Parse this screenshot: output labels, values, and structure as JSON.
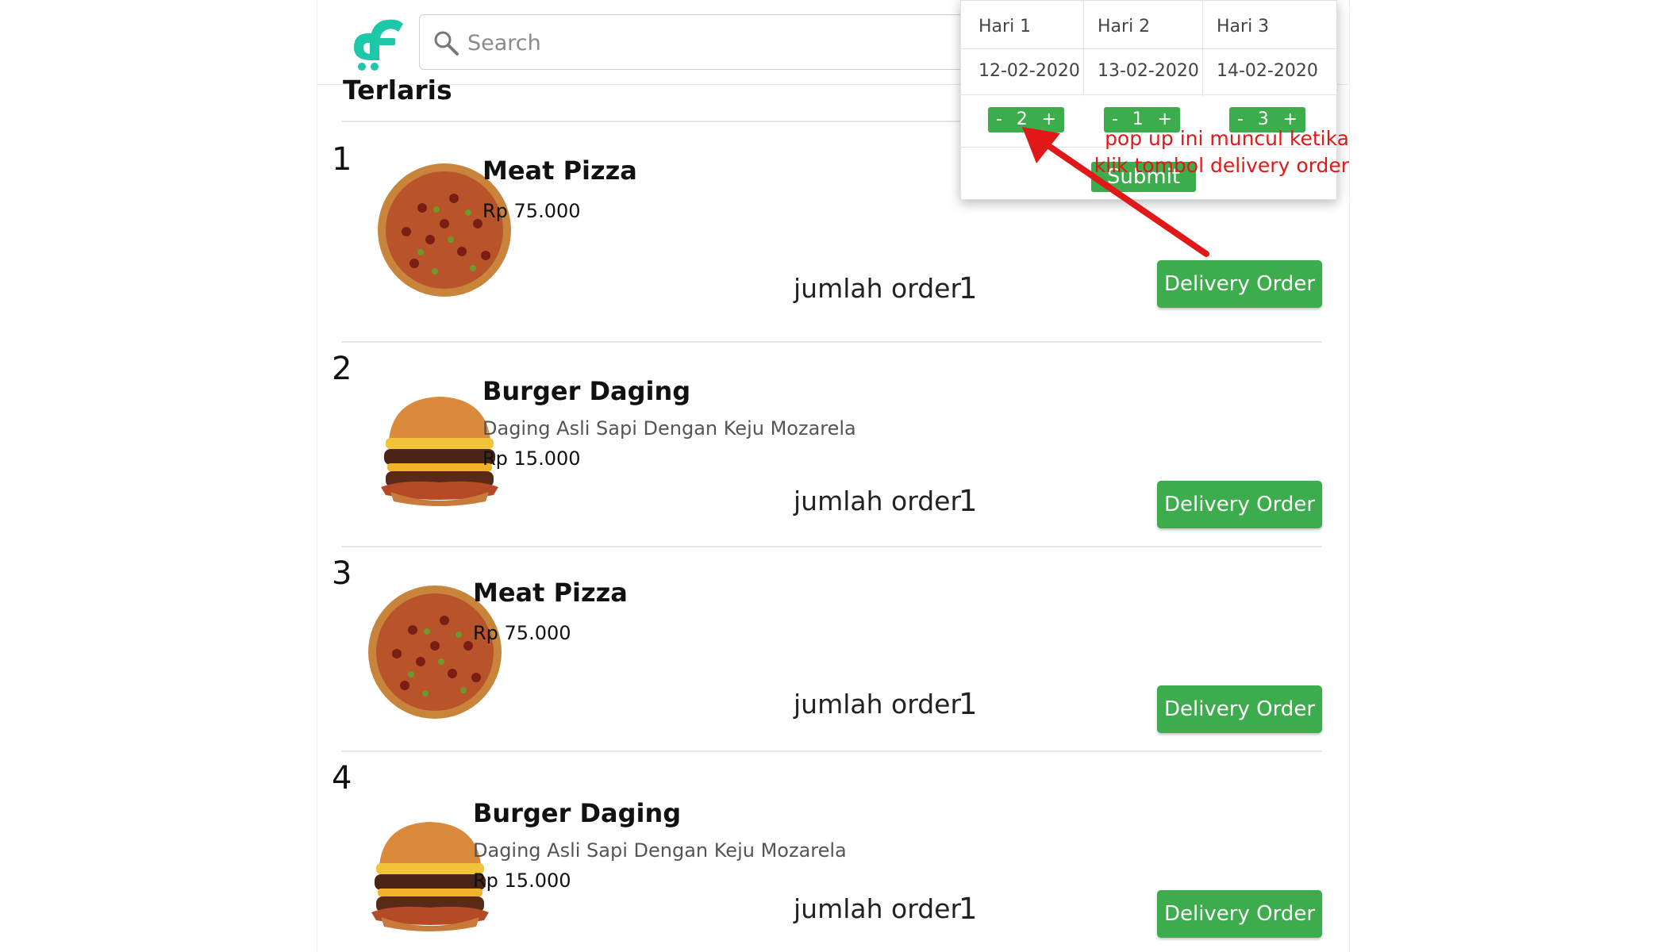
{
  "header": {
    "search_placeholder": "Search"
  },
  "section": {
    "title": "Terlaris"
  },
  "items": [
    {
      "rank": "1",
      "name": "Meat Pizza",
      "description": "",
      "price": "Rp 75.000",
      "qty_label": "jumlah order",
      "qty": "1",
      "button": "Delivery Order",
      "image": "pizza"
    },
    {
      "rank": "2",
      "name": "Burger Daging",
      "description": "Daging Asli Sapi Dengan Keju Mozarela",
      "price": "Rp 15.000",
      "qty_label": "jumlah order",
      "qty": "1",
      "button": "Delivery Order",
      "image": "burger"
    },
    {
      "rank": "3",
      "name": "Meat Pizza",
      "description": "",
      "price": "Rp 75.000",
      "qty_label": "jumlah order",
      "qty": "1",
      "button": "Delivery Order",
      "image": "pizza"
    },
    {
      "rank": "4",
      "name": "Burger Daging",
      "description": "Daging Asli Sapi Dengan Keju Mozarela",
      "price": "Rp 15.000",
      "qty_label": "jumlah order",
      "qty": "1",
      "button": "Delivery Order",
      "image": "burger"
    }
  ],
  "popup": {
    "days": [
      {
        "label": "Hari 1",
        "date": "12-02-2020",
        "qty": "2"
      },
      {
        "label": "Hari 2",
        "date": "13-02-2020",
        "qty": "1"
      },
      {
        "label": "Hari 3",
        "date": "14-02-2020",
        "qty": "3"
      }
    ],
    "minus": "-",
    "plus": "+",
    "submit": "Submit"
  },
  "annotation": {
    "line1": "pop up ini muncul ketika",
    "line2": "klik tombol delivery order"
  },
  "colors": {
    "brand_green": "#3cac4c",
    "logo_teal": "#1cc8a8",
    "annotation_red": "#e01818"
  }
}
